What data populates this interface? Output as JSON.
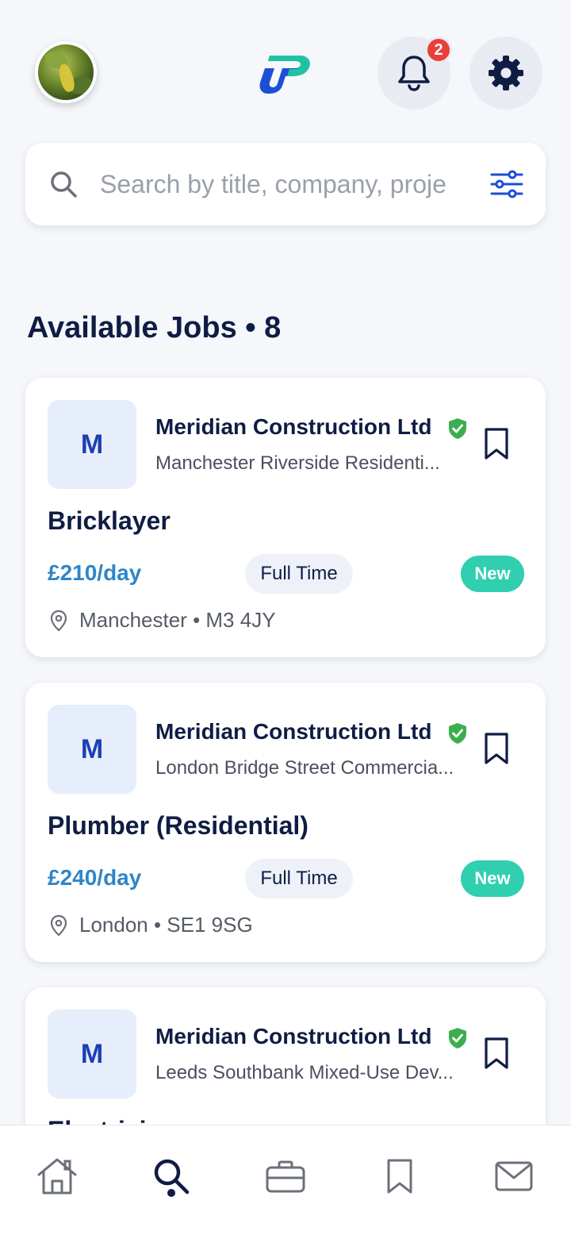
{
  "header": {
    "avatar_icon": "user-avatar-photo",
    "logo_icon": "app-logo",
    "notifications": {
      "icon": "bell-icon",
      "count": "2"
    },
    "settings": {
      "icon": "gear-icon"
    }
  },
  "search": {
    "placeholder": "Search by title, company, proje",
    "icon": "search-icon",
    "filter_icon": "sliders-icon"
  },
  "section": {
    "title": "Available Jobs • 8"
  },
  "jobs": [
    {
      "initial": "M",
      "company": "Meridian Construction Ltd",
      "project": "Manchester Riverside Residenti...",
      "title": "Bricklayer",
      "rate": "£210/day",
      "type": "Full Time",
      "badge": "New",
      "location": "Manchester • M3 4JY"
    },
    {
      "initial": "M",
      "company": "Meridian Construction Ltd",
      "project": "London Bridge Street Commercia...",
      "title": "Plumber (Residential)",
      "rate": "£240/day",
      "type": "Full Time",
      "badge": "New",
      "location": "London • SE1 9SG"
    },
    {
      "initial": "M",
      "company": "Meridian Construction Ltd",
      "project": "Leeds Southbank Mixed-Use Dev...",
      "title": "Electrician",
      "rate": "",
      "type": "",
      "badge": "",
      "location": ""
    }
  ],
  "bottom_nav": {
    "items": [
      {
        "icon": "home-icon",
        "active": false
      },
      {
        "icon": "search-icon",
        "active": true
      },
      {
        "icon": "briefcase-icon",
        "active": false
      },
      {
        "icon": "bookmark-icon",
        "active": false
      },
      {
        "icon": "mail-icon",
        "active": false
      }
    ]
  },
  "colors": {
    "primary_text": "#0f1d44",
    "rate_blue": "#2f86c9",
    "new_badge": "#2fcfb0",
    "verified_green": "#3dae4e",
    "notification_red": "#e83f3a",
    "background": "#f5f7fb"
  }
}
